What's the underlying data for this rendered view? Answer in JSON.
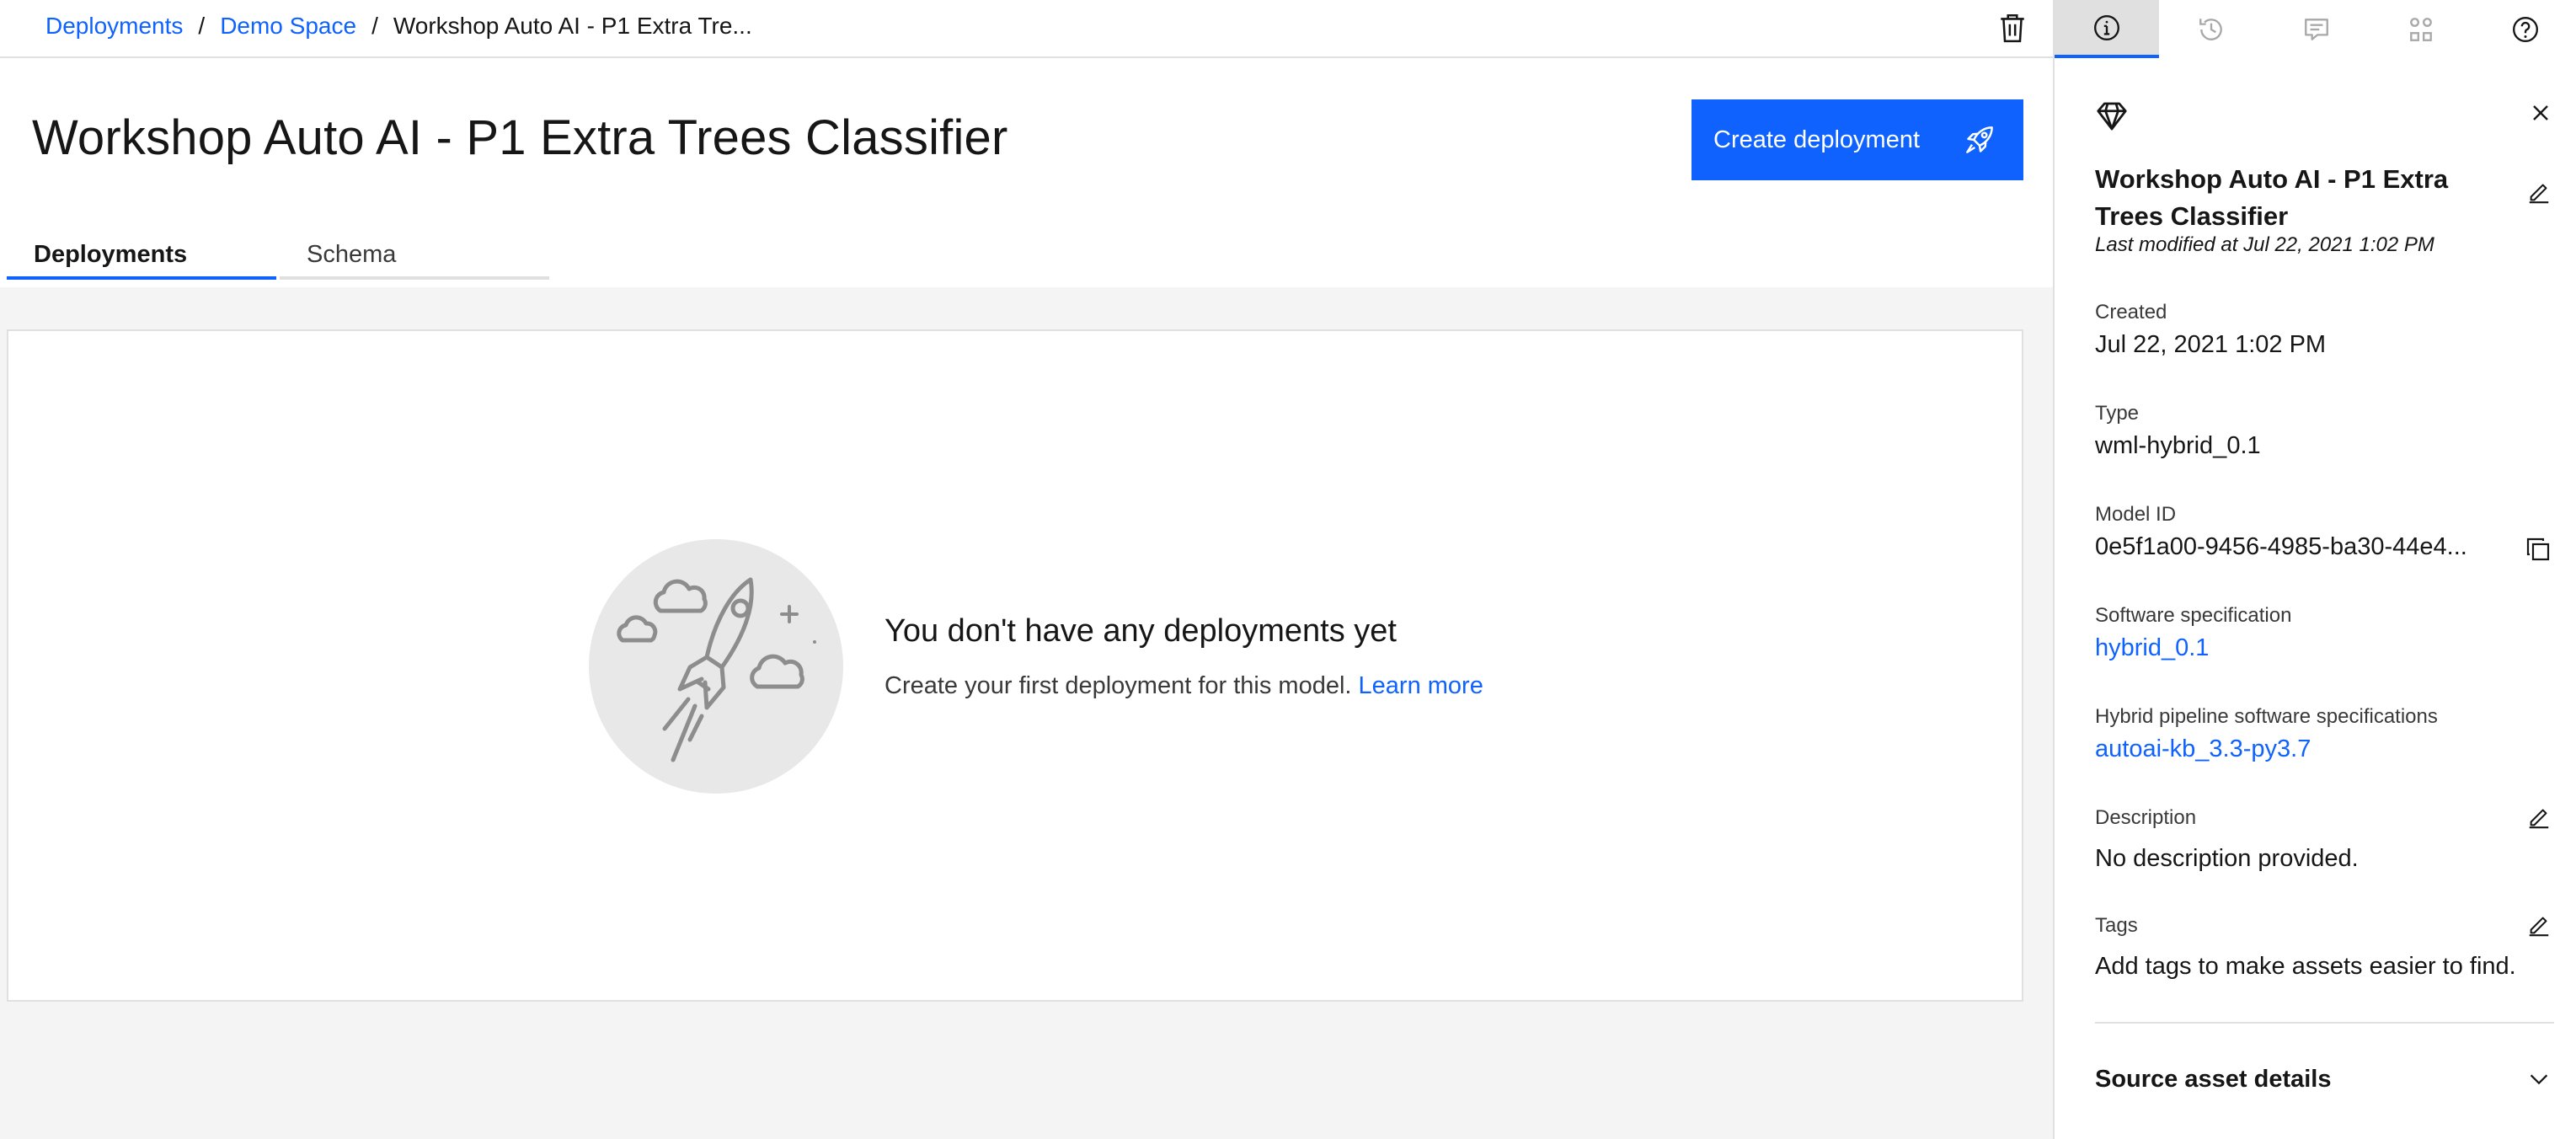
{
  "breadcrumb": {
    "items": [
      "Deployments",
      "Demo Space"
    ],
    "separator": "/",
    "current": "Workshop Auto AI - P1 Extra Tre..."
  },
  "page": {
    "title": "Workshop Auto AI - P1 Extra Trees Classifier",
    "create_button": "Create deployment"
  },
  "tabs": [
    {
      "label": "Deployments",
      "active": true
    },
    {
      "label": "Schema",
      "active": false
    }
  ],
  "empty_state": {
    "title": "You don't have any deployments yet",
    "subtitle": "Create your first deployment for this model.",
    "link": "Learn more"
  },
  "panel": {
    "tabs": [
      {
        "icon": "information-icon",
        "active": true
      },
      {
        "icon": "history-icon",
        "active": false
      },
      {
        "icon": "comment-icon",
        "active": false
      },
      {
        "icon": "related-assets-icon",
        "active": false
      },
      {
        "icon": "help-icon",
        "active": false
      }
    ],
    "asset_name": "Workshop Auto AI - P1 Extra Trees Classifier",
    "last_modified": "Last modified at Jul 22, 2021 1:02 PM",
    "fields": {
      "created": {
        "label": "Created",
        "value": "Jul 22, 2021 1:02 PM"
      },
      "type": {
        "label": "Type",
        "value": "wml-hybrid_0.1"
      },
      "model_id": {
        "label": "Model ID",
        "value": "0e5f1a00-9456-4985-ba30-44e4..."
      },
      "software_spec": {
        "label": "Software specification",
        "value": "hybrid_0.1"
      },
      "hybrid_spec": {
        "label": "Hybrid pipeline software specifications",
        "value": "autoai-kb_3.3-py3.7"
      },
      "description": {
        "label": "Description",
        "value": "No description provided."
      },
      "tags": {
        "label": "Tags",
        "value": "Add tags to make assets easier to find."
      }
    },
    "source_section": "Source asset details"
  },
  "colors": {
    "accent": "#0f62fe",
    "background": "#f4f4f4",
    "surface": "#ffffff",
    "border": "#e0e0e0"
  }
}
